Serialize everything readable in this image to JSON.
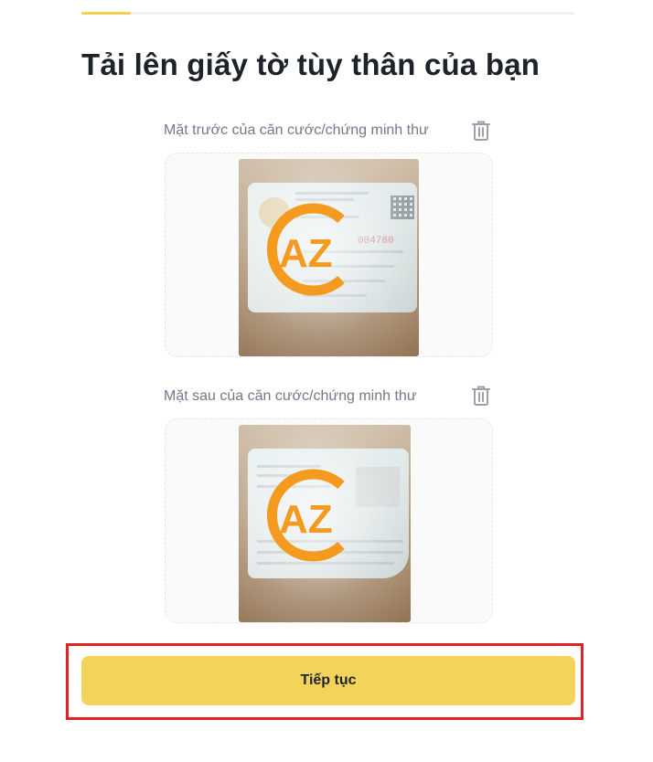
{
  "progress": {
    "fraction": 0.1
  },
  "page": {
    "title": "Tải lên giấy tờ tùy thân của bạn"
  },
  "front": {
    "label": "Mặt trước của căn cước/chứng minh thư",
    "delete_icon": "trash-icon",
    "watermark": "AZ",
    "card_number": "004780"
  },
  "back": {
    "label": "Mặt sau của căn cước/chứng minh thư",
    "delete_icon": "trash-icon",
    "watermark": "AZ"
  },
  "actions": {
    "continue_label": "Tiếp tục"
  },
  "colors": {
    "accent": "#f3d35a",
    "watermark": "#f39a1f",
    "highlight": "#e02424"
  }
}
